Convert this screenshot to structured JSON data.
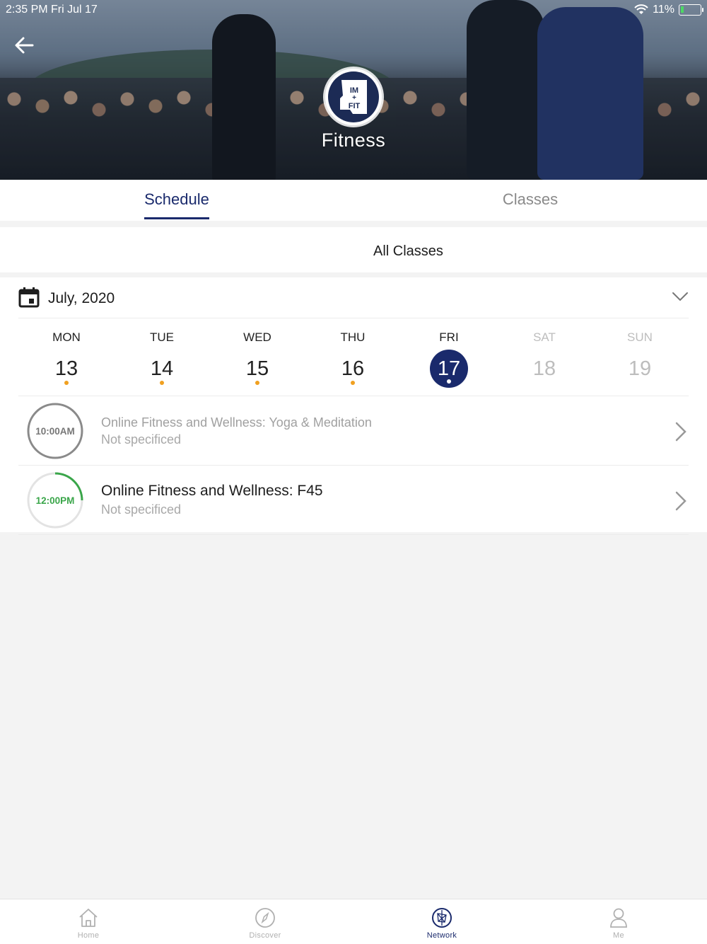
{
  "status_bar": {
    "time": "2:35 PM   Fri Jul 17",
    "battery": "11%"
  },
  "header": {
    "title": "Fitness",
    "logo_text_top": "IM",
    "logo_text_mid": "+",
    "logo_text_bottom": "FIT"
  },
  "tabs": [
    {
      "label": "Schedule",
      "active": true
    },
    {
      "label": "Classes",
      "active": false
    }
  ],
  "filter": {
    "label": "All Classes"
  },
  "calendar": {
    "month": "July,  2020",
    "days": [
      {
        "name": "MON",
        "num": "13",
        "has_event": true
      },
      {
        "name": "TUE",
        "num": "14",
        "has_event": true
      },
      {
        "name": "WED",
        "num": "15",
        "has_event": true
      },
      {
        "name": "THU",
        "num": "16",
        "has_event": true
      },
      {
        "name": "FRI",
        "num": "17",
        "selected": true
      },
      {
        "name": "SAT",
        "num": "18"
      },
      {
        "name": "SUN",
        "num": "19"
      }
    ]
  },
  "classes": [
    {
      "time": "10:00AM",
      "title": "Online Fitness and Wellness:  Yoga & Meditation",
      "location": "Not specificed"
    },
    {
      "time": "12:00PM",
      "title": "Online Fitness and Wellness: F45",
      "location": "Not specificed"
    }
  ],
  "bottom_nav": [
    {
      "label": "Home"
    },
    {
      "label": "Discover"
    },
    {
      "label": "Network",
      "active": true
    },
    {
      "label": "Me"
    }
  ],
  "colors": {
    "accent": "#1a2a6c",
    "event_dot": "#f0a020",
    "progress": "#3aa64a"
  }
}
